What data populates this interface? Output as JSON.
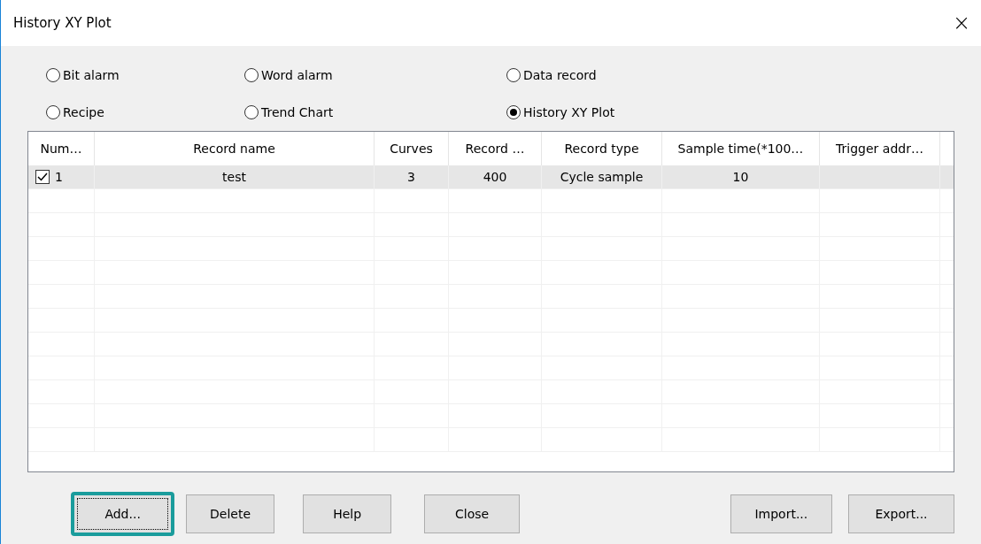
{
  "window": {
    "title": "History XY Plot",
    "close": "×"
  },
  "radios": [
    {
      "label": "Bit alarm",
      "selected": false
    },
    {
      "label": "Word alarm",
      "selected": false
    },
    {
      "label": "Data record",
      "selected": false
    },
    {
      "label": "Recipe",
      "selected": false
    },
    {
      "label": "Trend Chart",
      "selected": false
    },
    {
      "label": "History XY Plot",
      "selected": true
    }
  ],
  "table": {
    "columns": [
      "Num…",
      "Record name",
      "Curves",
      "Record …",
      "Record type",
      "Sample time(*100…",
      "Trigger addr…"
    ],
    "rows": [
      {
        "checked": true,
        "selected": true,
        "cells": [
          "1",
          "test",
          "3",
          "400",
          "Cycle sample",
          "10",
          ""
        ]
      }
    ]
  },
  "buttons": [
    {
      "label": "Add...",
      "focused": true
    },
    {
      "label": "Delete",
      "focused": false
    },
    {
      "label": "Help",
      "focused": false
    },
    {
      "label": "Close",
      "focused": false
    },
    {
      "label": "Import...",
      "focused": false
    },
    {
      "label": "Export...",
      "focused": false
    }
  ]
}
